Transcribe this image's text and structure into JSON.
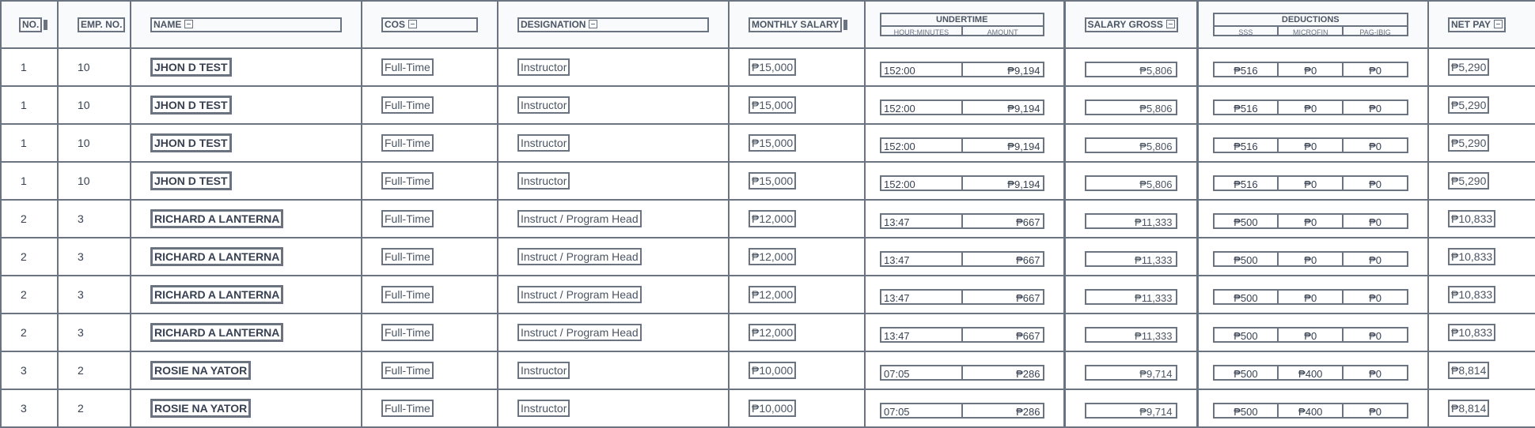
{
  "headers": {
    "no": "NO.",
    "emp_no": "EMP. NO.",
    "name": "NAME",
    "cos": "COS",
    "designation": "DESIGNATION",
    "monthly_salary": "MONTHLY SALARY",
    "undertime": "UNDERTIME",
    "undertime_subs": [
      "HOUR:MINUTES",
      "AMOUNT"
    ],
    "salary_gross": "SALARY GROSS",
    "deductions": "DEDUCTIONS",
    "deductions_subs": [
      "SSS",
      "MICROFIN",
      "PAG-IBIG"
    ],
    "net_pay": "NET PAY"
  },
  "rows": [
    {
      "no": "1",
      "emp_no": "10",
      "name": "JHON D TEST",
      "cos": "Full-Time",
      "designation": "Instructor",
      "monthly_salary": "₱15,000",
      "ut_time": "152:00",
      "ut_amount": "₱9,194",
      "gross": "₱5,806",
      "sss": "₱516",
      "microfin": "₱0",
      "pagibig": "₱0",
      "net_pay": "₱5,290"
    },
    {
      "no": "1",
      "emp_no": "10",
      "name": "JHON D TEST",
      "cos": "Full-Time",
      "designation": "Instructor",
      "monthly_salary": "₱15,000",
      "ut_time": "152:00",
      "ut_amount": "₱9,194",
      "gross": "₱5,806",
      "sss": "₱516",
      "microfin": "₱0",
      "pagibig": "₱0",
      "net_pay": "₱5,290"
    },
    {
      "no": "1",
      "emp_no": "10",
      "name": "JHON D TEST",
      "cos": "Full-Time",
      "designation": "Instructor",
      "monthly_salary": "₱15,000",
      "ut_time": "152:00",
      "ut_amount": "₱9,194",
      "gross": "₱5,806",
      "sss": "₱516",
      "microfin": "₱0",
      "pagibig": "₱0",
      "net_pay": "₱5,290"
    },
    {
      "no": "1",
      "emp_no": "10",
      "name": "JHON D TEST",
      "cos": "Full-Time",
      "designation": "Instructor",
      "monthly_salary": "₱15,000",
      "ut_time": "152:00",
      "ut_amount": "₱9,194",
      "gross": "₱5,806",
      "sss": "₱516",
      "microfin": "₱0",
      "pagibig": "₱0",
      "net_pay": "₱5,290"
    },
    {
      "no": "2",
      "emp_no": "3",
      "name": "RICHARD A LANTERNA",
      "cos": "Full-Time",
      "designation": "Instruct / Program Head",
      "monthly_salary": "₱12,000",
      "ut_time": "13:47",
      "ut_amount": "₱667",
      "gross": "₱11,333",
      "sss": "₱500",
      "microfin": "₱0",
      "pagibig": "₱0",
      "net_pay": "₱10,833"
    },
    {
      "no": "2",
      "emp_no": "3",
      "name": "RICHARD A LANTERNA",
      "cos": "Full-Time",
      "designation": "Instruct / Program Head",
      "monthly_salary": "₱12,000",
      "ut_time": "13:47",
      "ut_amount": "₱667",
      "gross": "₱11,333",
      "sss": "₱500",
      "microfin": "₱0",
      "pagibig": "₱0",
      "net_pay": "₱10,833"
    },
    {
      "no": "2",
      "emp_no": "3",
      "name": "RICHARD A LANTERNA",
      "cos": "Full-Time",
      "designation": "Instruct / Program Head",
      "monthly_salary": "₱12,000",
      "ut_time": "13:47",
      "ut_amount": "₱667",
      "gross": "₱11,333",
      "sss": "₱500",
      "microfin": "₱0",
      "pagibig": "₱0",
      "net_pay": "₱10,833"
    },
    {
      "no": "2",
      "emp_no": "3",
      "name": "RICHARD A LANTERNA",
      "cos": "Full-Time",
      "designation": "Instruct / Program Head",
      "monthly_salary": "₱12,000",
      "ut_time": "13:47",
      "ut_amount": "₱667",
      "gross": "₱11,333",
      "sss": "₱500",
      "microfin": "₱0",
      "pagibig": "₱0",
      "net_pay": "₱10,833"
    },
    {
      "no": "3",
      "emp_no": "2",
      "name": "ROSIE NA YATOR",
      "cos": "Full-Time",
      "designation": "Instructor",
      "monthly_salary": "₱10,000",
      "ut_time": "07:05",
      "ut_amount": "₱286",
      "gross": "₱9,714",
      "sss": "₱500",
      "microfin": "₱400",
      "pagibig": "₱0",
      "net_pay": "₱8,814"
    },
    {
      "no": "3",
      "emp_no": "2",
      "name": "ROSIE NA YATOR",
      "cos": "Full-Time",
      "designation": "Instructor",
      "monthly_salary": "₱10,000",
      "ut_time": "07:05",
      "ut_amount": "₱286",
      "gross": "₱9,714",
      "sss": "₱500",
      "microfin": "₱400",
      "pagibig": "₱0",
      "net_pay": "₱8,814"
    }
  ]
}
